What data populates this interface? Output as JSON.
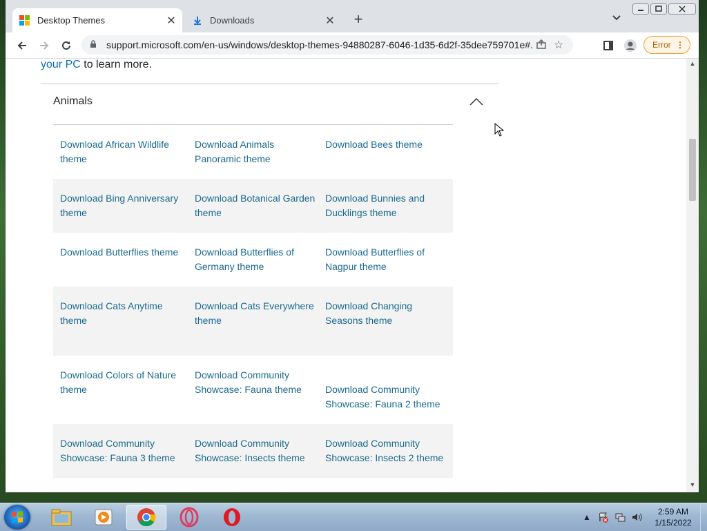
{
  "browser": {
    "tabs": [
      {
        "title": "Desktop Themes",
        "active": true
      },
      {
        "title": "Downloads",
        "active": false
      }
    ],
    "new_tab": "+",
    "url": "support.microsoft.com/en-us/windows/desktop-themes-94880287-6046-1d35-6d2f-35dee759701e#...",
    "error_label": "Error"
  },
  "page": {
    "intro_link": "your PC",
    "intro_text": " to learn more.",
    "section_title": "Animals",
    "rows": [
      [
        "Download African Wildlife theme",
        "Download Animals Panoramic theme",
        "Download Bees theme"
      ],
      [
        "Download Bing Anniversary theme",
        "Download Botanical Garden theme",
        "Download Bunnies and Ducklings theme"
      ],
      [
        "Download Butterflies theme",
        "Download Butterflies of Germany theme",
        "Download Butterflies of Nagpur theme"
      ],
      [
        "Download Cats Anytime theme",
        "Download Cats Everywhere theme",
        "Download Changing Seasons theme"
      ],
      [
        "Download Colors of Nature theme",
        "Download Community Showcase: Fauna theme",
        "Download Community Showcase: Fauna 2 theme"
      ],
      [
        "Download Community Showcase: Fauna 3 theme",
        "Download Community Showcase: Insects theme",
        "Download Community Showcase: Insects 2 theme"
      ]
    ]
  },
  "taskbar": {
    "items": [
      "windows-explorer",
      "media-player",
      "chrome",
      "opera-gx",
      "opera"
    ],
    "clock_time": "2:59 AM",
    "clock_date": "1/15/2022"
  },
  "colors": {
    "link": "#1a6a8e",
    "alt_row": "#f3f3f3",
    "error_border": "#e8a33a"
  }
}
